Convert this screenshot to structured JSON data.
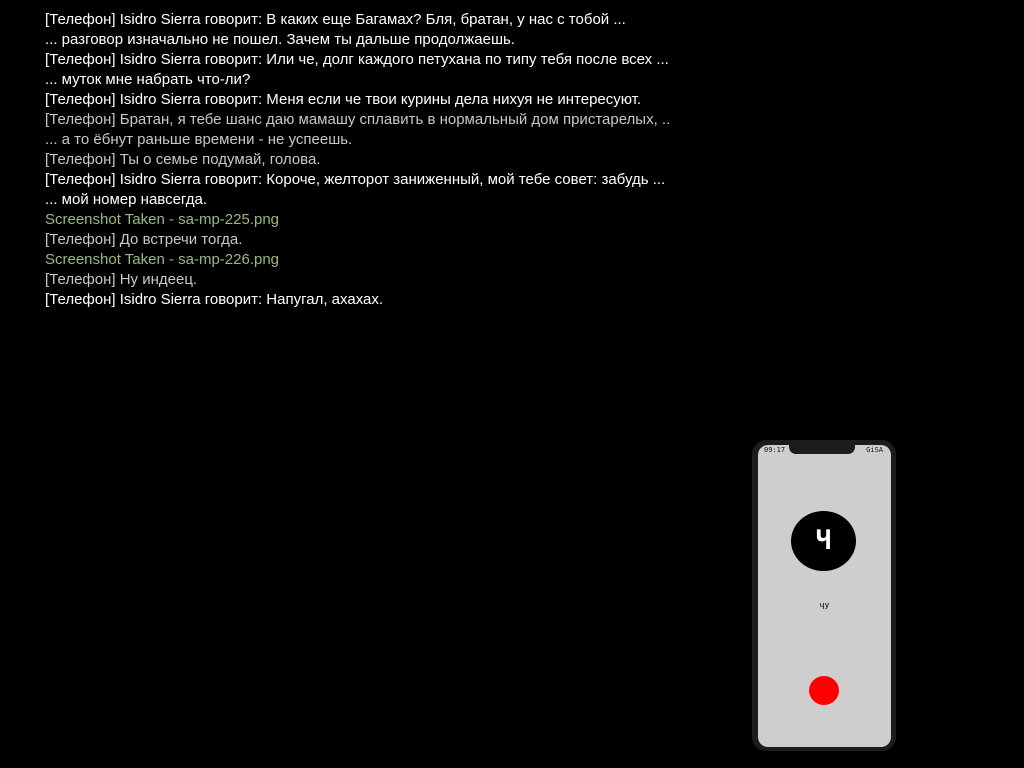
{
  "chat": {
    "lines": [
      {
        "text": "[Телефон] Isidro Sierra говорит: В каких еще Багамах? Бля, братан, у нас с тобой ...",
        "color": "#ffffff"
      },
      {
        "text": "... разговор изначально не пошел. Зачем ты дальше продолжаешь.",
        "color": "#ffffff"
      },
      {
        "text": "[Телефон] Isidro Sierra говорит: Или че, долг каждого петухана по типу тебя после всех ...",
        "color": "#ffffff"
      },
      {
        "text": "... муток мне набрать что-ли?",
        "color": "#ffffff"
      },
      {
        "text": "[Телефон] Isidro Sierra говорит: Меня если че твои курины дела нихуя не интересуют.",
        "color": "#ffffff"
      },
      {
        "text": "[Телефон] Братан, я тебе шанс даю мамашу сплавить в нормальный дом пристарелых, ..",
        "color": "#c8c8c8"
      },
      {
        "text": "... а то ёбнут раньше времени - не успеешь.",
        "color": "#c8c8c8"
      },
      {
        "text": "[Телефон] Ты о семье подумай, голова.",
        "color": "#c8c8c8"
      },
      {
        "text": "[Телефон] Isidro Sierra говорит: Короче, желторот заниженный, мой тебе совет: забудь ...",
        "color": "#ffffff"
      },
      {
        "text": "... мой номер навсегда.",
        "color": "#ffffff"
      },
      {
        "text": "Screenshot Taken - sa-mp-225.png",
        "color": "#9ab87c"
      },
      {
        "text": "[Телефон] До встречи тогда.",
        "color": "#c8c8c8"
      },
      {
        "text": "Screenshot Taken - sa-mp-226.png",
        "color": "#9ab87c"
      },
      {
        "text": "[Телефон] Ну индеец.",
        "color": "#c8c8c8"
      },
      {
        "text": "[Телефон] Isidro Sierra говорит: Напугал, ахахах.",
        "color": "#ffffff"
      }
    ]
  },
  "phone": {
    "status_time": "09:17",
    "status_network": "GiSA",
    "caller_initial": "Ч",
    "caller_name": "ЧУ",
    "hangup_color": "#ff0000"
  }
}
